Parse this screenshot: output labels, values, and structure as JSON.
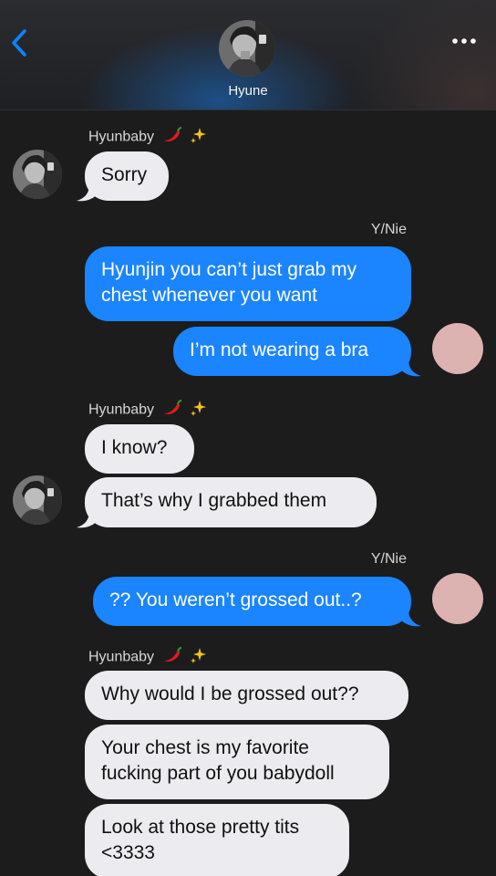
{
  "header": {
    "contact_name": "Hyune"
  },
  "labels": {
    "incoming_sender": "Hyunbaby",
    "outgoing_sender": "Y/Nie"
  },
  "messages": [
    {
      "dir": "in",
      "text": "Sorry"
    },
    {
      "dir": "out",
      "text": "Hyunjin you can’t just grab my chest whenever you want"
    },
    {
      "dir": "out",
      "text": "I’m not wearing a bra"
    },
    {
      "dir": "in",
      "text": "I know?"
    },
    {
      "dir": "in",
      "text": "That’s why I grabbed them"
    },
    {
      "dir": "out",
      "text": "?? You weren’t grossed out..?"
    },
    {
      "dir": "in",
      "text": "Why would I be grossed out??"
    },
    {
      "dir": "in",
      "text": "Your chest is my favorite fucking part of you babydoll"
    },
    {
      "dir": "in",
      "text": "Look at those pretty tits <3333"
    }
  ],
  "colors": {
    "outgoing_bubble": "#1b84ff",
    "incoming_bubble": "#ebebf0",
    "background": "#1c1c1d",
    "accent": "#0a84ff",
    "user_avatar": "#dcb3b1"
  },
  "icons": {
    "back": "chevron-left-icon",
    "more": "ellipsis-icon",
    "sender_emoji_1": "chili-pepper-icon",
    "sender_emoji_2": "sparkles-icon"
  }
}
